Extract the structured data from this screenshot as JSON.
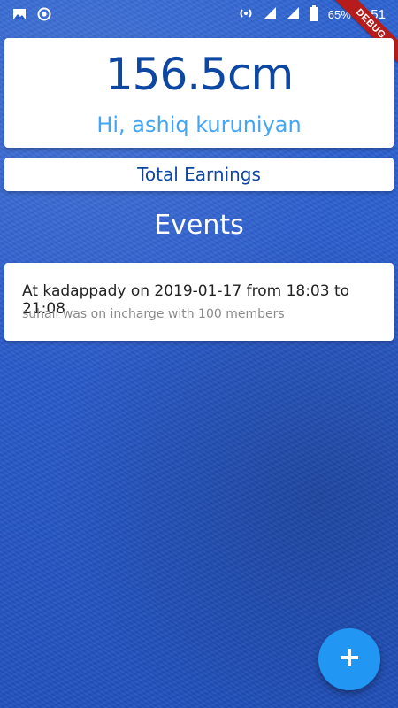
{
  "status_bar": {
    "battery_percent": "65%",
    "time": "3:51",
    "debug_label": "DEBUG",
    "icons": [
      "image-icon",
      "record-icon",
      "hotspot-icon",
      "signal-icon",
      "signal-icon",
      "battery-icon"
    ]
  },
  "profile_card": {
    "height_value": "156.5cm",
    "greeting": "Hi, ashiq kuruniyan"
  },
  "earnings_card": {
    "label": "Total Earnings"
  },
  "events": {
    "heading": "Events",
    "items": [
      {
        "title": "At kadappady on 2019-01-17 from 18:03 to 21:08",
        "subtitle": "suhail was on incharge with 100 members"
      }
    ]
  },
  "fab": {
    "icon": "plus-icon"
  },
  "colors": {
    "primary_dark": "#0d47a1",
    "accent": "#42a5f5",
    "fab": "#2196f3",
    "background": "#2a5ccd"
  }
}
